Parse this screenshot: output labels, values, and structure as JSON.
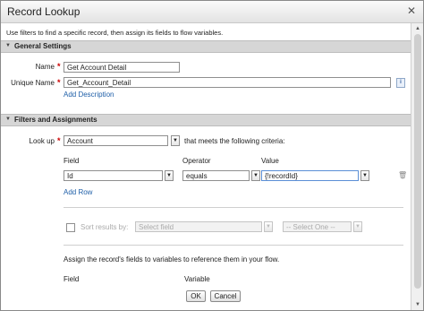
{
  "dialog": {
    "title": "Record Lookup",
    "description": "Use filters to find a specific record, then assign its fields to flow variables."
  },
  "general": {
    "header": "General Settings",
    "name_label": "Name",
    "name_value": "Get Account Detail",
    "unique_name_label": "Unique Name",
    "unique_name_value": "Get_Account_Detail",
    "info_icon_text": "i",
    "add_description": "Add Description"
  },
  "filters": {
    "header": "Filters and Assignments",
    "lookup_label": "Look up",
    "lookup_value": "Account",
    "criteria_text": "that meets the following criteria:",
    "col_field": "Field",
    "col_operator": "Operator",
    "col_value": "Value",
    "row": {
      "field": "Id",
      "operator": "equals",
      "value": "{!recordId}"
    },
    "add_row": "Add Row",
    "sort_label": "Sort results by:",
    "sort_field_placeholder": "Select field",
    "sort_order_placeholder": "-- Select One --",
    "assign_text": "Assign the record's fields to variables to reference them in your flow.",
    "assign_col_field": "Field",
    "assign_col_variable": "Variable"
  },
  "footer": {
    "ok": "OK",
    "cancel": "Cancel"
  },
  "icons": {
    "close": "close-icon",
    "collapse": "triangle-down-icon",
    "required": "required-asterisk-icon",
    "dropdown": "chevron-down-icon",
    "delete": "trash-icon",
    "info": "info-icon"
  },
  "colors": {
    "link": "#1f5fa8",
    "required": "#cc0000",
    "section_bg": "#d6d6d6"
  }
}
